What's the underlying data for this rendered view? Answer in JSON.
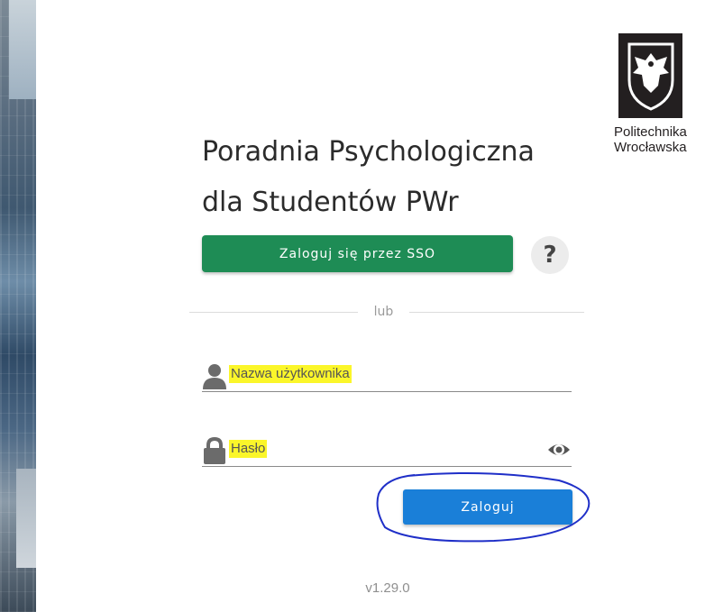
{
  "brand": {
    "logo_text_line1": "Politechnika",
    "logo_text_line2": "Wrocławska"
  },
  "page": {
    "title_line1": "Poradnia Psychologiczna",
    "title_line2": "dla Studentów PWr"
  },
  "sso": {
    "button_label": "Zaloguj się przez SSO",
    "help_label": "?",
    "color": "#1e8c55"
  },
  "divider": {
    "text": "lub"
  },
  "form": {
    "username_placeholder": "Nazwa użytkownika",
    "password_placeholder": "Hasło",
    "login_label": "Zaloguj",
    "login_color": "#1a7fd8",
    "highlight_color": "#fbf62a"
  },
  "footer": {
    "version": "v1.29.0"
  }
}
